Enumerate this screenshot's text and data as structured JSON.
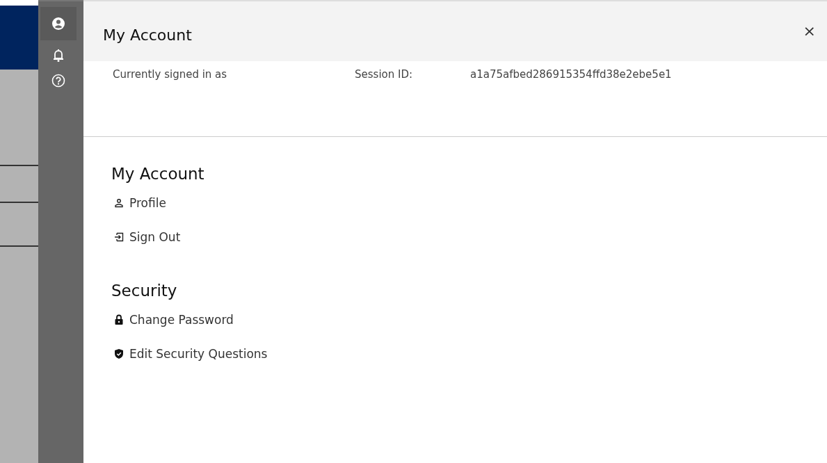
{
  "rail": [
    {
      "kind": "account",
      "selected": true
    },
    {
      "kind": "bell",
      "selected": false
    },
    {
      "kind": "help",
      "selected": false
    }
  ],
  "panel": {
    "title": "My Account",
    "close": "×",
    "signed_in_label": "Currently signed in as",
    "session_label": "Session ID:",
    "session_id": "a1a75afbed286915354ffd38e2ebe5e1"
  },
  "sections": [
    {
      "heading": "My Account",
      "items": [
        {
          "kind": "person",
          "label": "Profile"
        },
        {
          "kind": "signout",
          "label": "Sign Out"
        }
      ]
    },
    {
      "heading": "Security",
      "items": [
        {
          "kind": "lock",
          "label": "Change Password"
        },
        {
          "kind": "shield",
          "label": "Edit Security Questions"
        }
      ]
    }
  ]
}
